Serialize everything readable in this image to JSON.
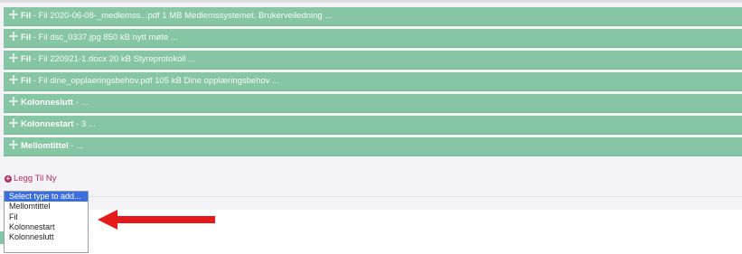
{
  "rows": [
    {
      "type": "Fil",
      "description": "Fil 2020-06-08-_medlemss...pdf 1 MB Medlemssystemet. Brukerveiledning ..."
    },
    {
      "type": "Fil",
      "description": "Fil dsc_0337.jpg 850 kB nytt møte ..."
    },
    {
      "type": "Fil",
      "description": "Fil 220921-1.docx 20 kB Styreprotokoll ..."
    },
    {
      "type": "Fil",
      "description": "Fil dine_opplaeringsbehov.pdf 105 kB Dine opplæringsbehov ..."
    },
    {
      "type": "Kolonneslutt",
      "description": "..."
    },
    {
      "type": "Kolonnestart",
      "description": "3 ..."
    },
    {
      "type": "Mellomtittel",
      "description": "..."
    }
  ],
  "separator": "-",
  "add_new_label": "Legg Til Ny",
  "dropdown": {
    "selected": "Select type to add...",
    "options": [
      "Mellomtittel",
      "Fil",
      "Kolonnestart",
      "Kolonneslutt"
    ]
  },
  "colors": {
    "row_bg": "#86c6a4",
    "accent": "#b4305f",
    "select_highlight": "#3b6fe0",
    "annotation_arrow": "#e31b1b"
  },
  "icons": {
    "row_handle": "move-icon",
    "add": "plus-circle-icon",
    "annotation": "arrow-left-icon"
  }
}
